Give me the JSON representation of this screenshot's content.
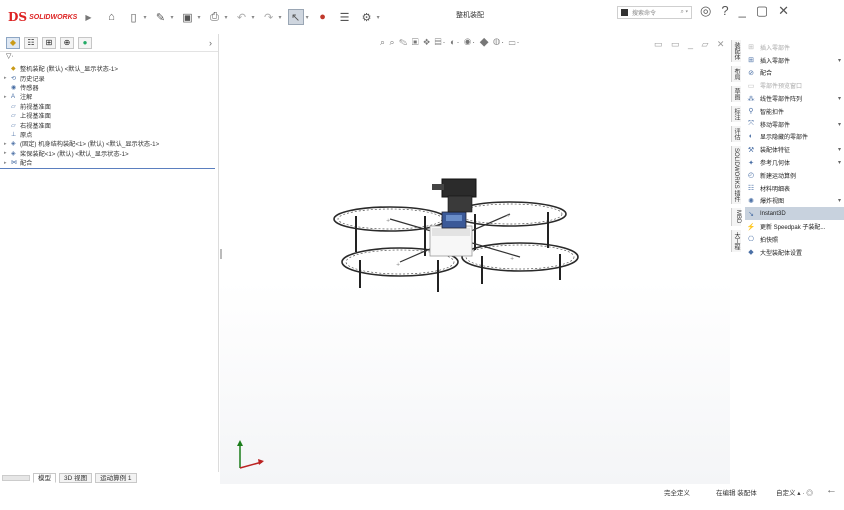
{
  "app": {
    "logo_mark": "DS",
    "logo_text": "SOLIDWORKS",
    "document_title": "整机装配",
    "search_placeholder": "搜索命令",
    "search_icon": "search-icon",
    "help_icon": "help-icon"
  },
  "toolbar": {
    "items": [
      "home-icon",
      "new-icon",
      "open-icon",
      "save-icon",
      "print-icon",
      "undo-icon",
      "redo-icon",
      "select-icon",
      "rebuild-icon",
      "file-properties-icon",
      "options-icon"
    ]
  },
  "window_controls": [
    "minimize-icon",
    "restore-icon",
    "close-icon"
  ],
  "feature_tree": {
    "panel_tabs": [
      "feature-manager-icon",
      "property-manager-icon",
      "configuration-manager-icon",
      "dimxpert-icon",
      "display-manager-icon"
    ],
    "filter_icon": "filter-icon",
    "rows": [
      {
        "label": "整机装配 (默认) <默认_显示状态-1>",
        "expand": "",
        "icon": "assembly-icon",
        "root": true
      },
      {
        "label": "历史记录",
        "expand": "▸",
        "icon": "history-icon"
      },
      {
        "label": "传感器",
        "expand": "",
        "icon": "sensor-icon"
      },
      {
        "label": "注解",
        "expand": "▸",
        "icon": "annotation-icon"
      },
      {
        "label": "前视基准面",
        "expand": "",
        "icon": "plane-icon"
      },
      {
        "label": "上视基准面",
        "expand": "",
        "icon": "plane-icon"
      },
      {
        "label": "右视基准面",
        "expand": "",
        "icon": "plane-icon"
      },
      {
        "label": "原点",
        "expand": "",
        "icon": "origin-icon"
      },
      {
        "label": "(固定) 机身结构装配<1> (默认) <默认_显示状态-1>",
        "expand": "▸",
        "icon": "subassembly-icon"
      },
      {
        "label": "桨保装配<1> (默认) <默认_显示状态-1>",
        "expand": "▸",
        "icon": "subassembly-icon"
      },
      {
        "label": "配合",
        "expand": "▸",
        "icon": "mates-icon"
      }
    ]
  },
  "bottom_tabs": [
    {
      "label": "模型",
      "active": true
    },
    {
      "label": "3D 视图",
      "active": false
    },
    {
      "label": "运动算例 1",
      "active": false
    }
  ],
  "status": {
    "defined": "完全定义",
    "editing": "在编辑 装配体",
    "units": "自定义"
  },
  "task_pane": {
    "vertical_tabs": [
      "装配体",
      "布局",
      "草图",
      "标注",
      "评估",
      "SOLIDWORKS 插件",
      "MBD",
      "大工程"
    ],
    "items": [
      {
        "label": "插入零部件",
        "icon": "insert-component-icon",
        "dropdown": false,
        "disabled": true
      },
      {
        "label": "插入零部件",
        "icon": "insert-component-icon",
        "dropdown": true,
        "disabled": false
      },
      {
        "label": "配合",
        "icon": "mate-icon",
        "dropdown": false,
        "disabled": false
      },
      {
        "label": "零部件预览窗口",
        "icon": "preview-icon",
        "dropdown": false,
        "disabled": true
      },
      {
        "label": "线性零部件阵列",
        "icon": "pattern-icon",
        "dropdown": true,
        "disabled": false
      },
      {
        "label": "智能扣件",
        "icon": "fastener-icon",
        "dropdown": false,
        "disabled": false
      },
      {
        "label": "移动零部件",
        "icon": "move-icon",
        "dropdown": true,
        "disabled": false
      },
      {
        "label": "显示隐藏的零部件",
        "icon": "show-hidden-icon",
        "dropdown": false,
        "disabled": false
      },
      {
        "label": "装配体特征",
        "icon": "assembly-feature-icon",
        "dropdown": true,
        "disabled": false
      },
      {
        "label": "参考几何体",
        "icon": "reference-geometry-icon",
        "dropdown": true,
        "disabled": false
      },
      {
        "label": "新建运动算例",
        "icon": "motion-study-icon",
        "dropdown": false,
        "disabled": false
      },
      {
        "label": "材料明细表",
        "icon": "bom-icon",
        "dropdown": false,
        "disabled": false
      },
      {
        "label": "爆炸视图",
        "icon": "explode-icon",
        "dropdown": true,
        "disabled": false
      },
      {
        "label": "Instant3D",
        "icon": "instant3d-icon",
        "dropdown": false,
        "disabled": false,
        "highlight": true
      },
      {
        "label": "更新 Speedpak 子装配...",
        "icon": "speedpak-icon",
        "dropdown": false,
        "disabled": false
      },
      {
        "label": "拍快照",
        "icon": "snapshot-icon",
        "dropdown": false,
        "disabled": false
      },
      {
        "label": "大型装配体设置",
        "icon": "large-assembly-icon",
        "dropdown": false,
        "disabled": false
      }
    ]
  },
  "colors": {
    "brand_red": "#d22222",
    "selection_blue": "#5b7fbf",
    "highlight": "#c8d2de"
  }
}
